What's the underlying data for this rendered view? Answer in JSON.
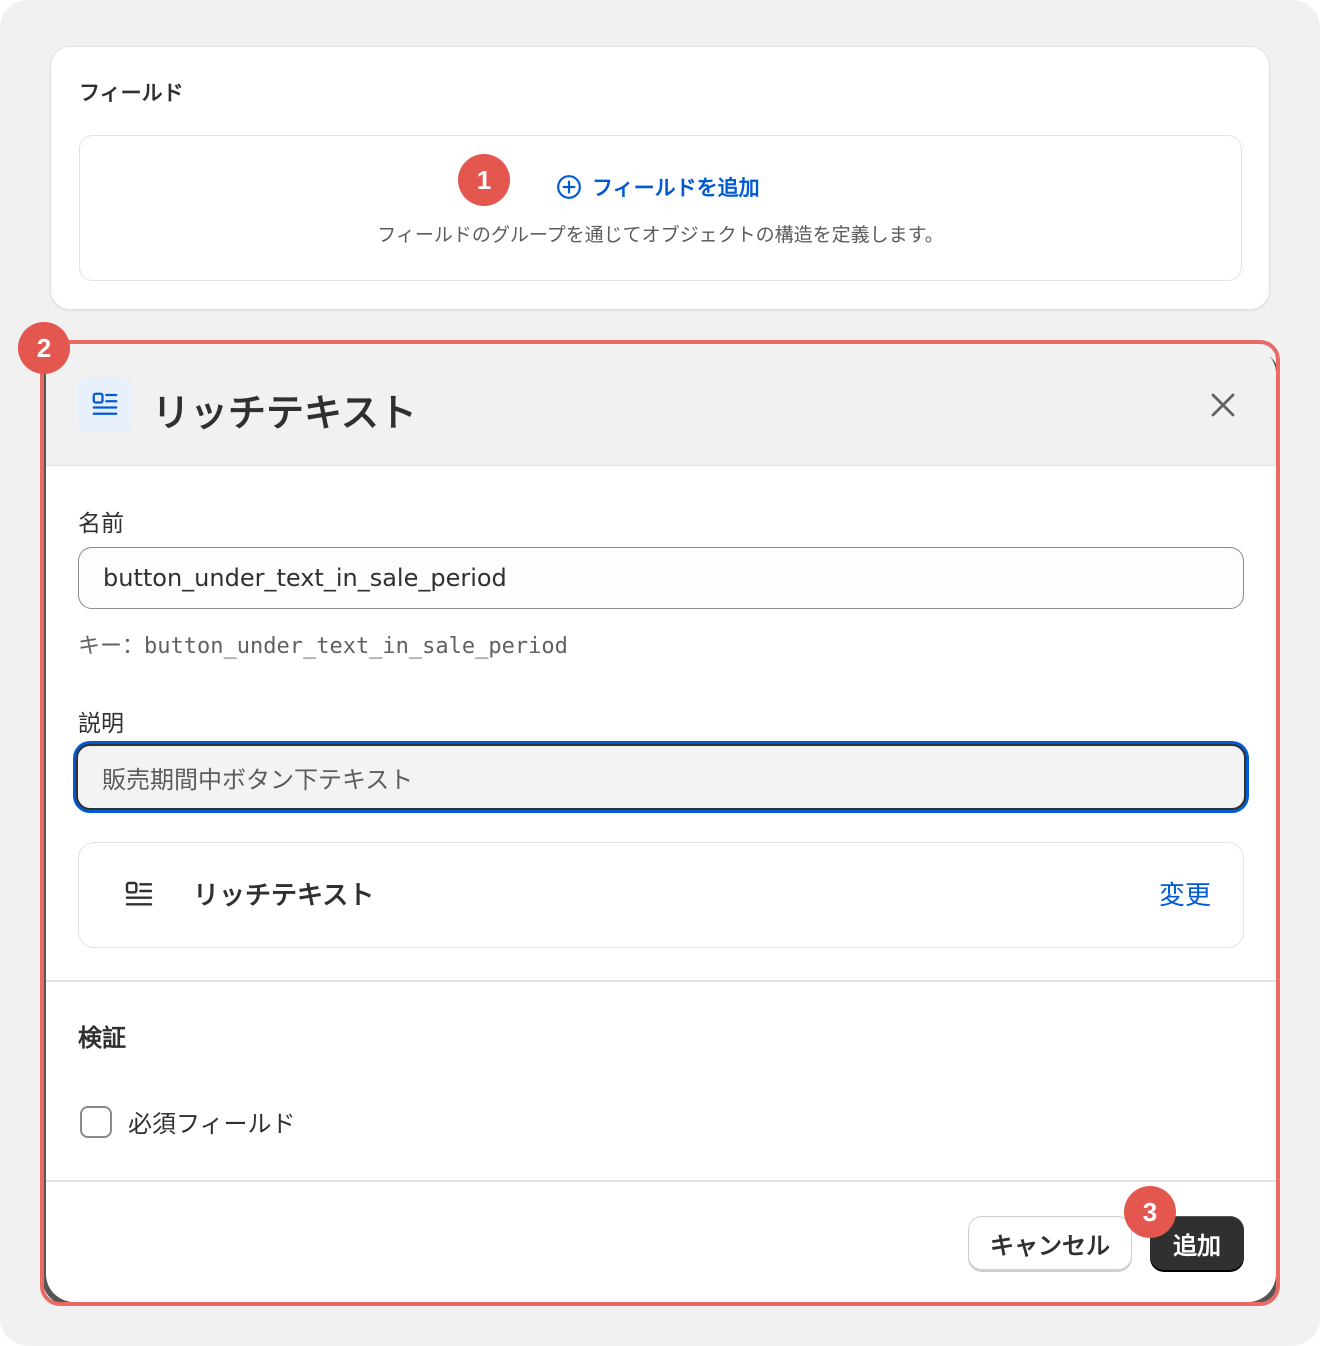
{
  "fields_card": {
    "title": "フィールド",
    "add_field_label": "フィールドを追加",
    "description": "フィールドのグループを通じてオブジェクトの構造を定義します。"
  },
  "markers": [
    "1",
    "2",
    "3"
  ],
  "modal": {
    "title": "リッチテキスト",
    "header_icon": "rich-text-icon",
    "name_label": "名前",
    "name_value": "button_under_text_in_sale_period",
    "key_prefix": "キー：",
    "key_value": "button_under_text_in_sale_period",
    "description_label": "説明",
    "description_value": "販売期間中ボタン下テキスト",
    "type_name": "リッチテキスト",
    "change_label": "変更",
    "validation_title": "検証",
    "required_label": "必須フィールド",
    "required_checked": false,
    "cancel_label": "キャンセル",
    "add_label": "追加"
  },
  "colors": {
    "accent": "#005bd3",
    "marker": "#e3574f",
    "highlight": "#e86a62",
    "primary_button": "#303030"
  }
}
